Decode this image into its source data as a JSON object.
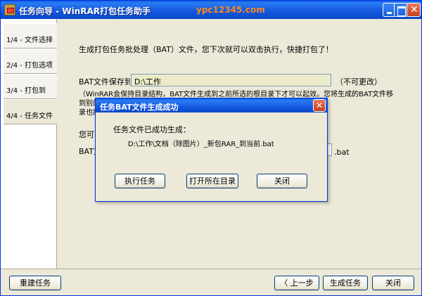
{
  "window": {
    "title": "任务向导 - WinRAR打包任务助手",
    "watermark": "ypc12345.com",
    "close_glyph": "✕"
  },
  "steps": [
    {
      "label": "1/4 - 文件选择"
    },
    {
      "label": "2/4 - 打包选项"
    },
    {
      "label": "3/4 -   打包到"
    },
    {
      "label": "4/4 - 任务文件"
    }
  ],
  "content": {
    "intro": "生成打包任务批处理（BAT）文件，您下次就可以双击执行，快捷打包了！",
    "path_label": "BAT文件保存到：",
    "path_value": "D:\\工作",
    "path_note": "（不可更改）",
    "desc_line1": "（WinRAR会保持目录结构，BAT文件生成到之前所选的根目录下才可以起效。您将生成的BAT文件移到别的目",
    "desc_line2": "录也將",
    "mid_label": "您可以",
    "name_label": "BAT文",
    "bat_ext": ".bat"
  },
  "buttons": {
    "rebuild": "重建任务",
    "prev": "〈 上一步",
    "generate": "生成任务",
    "close": "关闭"
  },
  "dialog": {
    "title": "任务BAT文件生成成功",
    "close_glyph": "✕",
    "message": "任务文件已成功生成：",
    "path": "D:\\工作\\文档（除图片）_新包RAR_到当前.bat",
    "buttons": {
      "execute": "执行任务",
      "open_dir": "打开所在目录",
      "close": "关闭"
    }
  }
}
